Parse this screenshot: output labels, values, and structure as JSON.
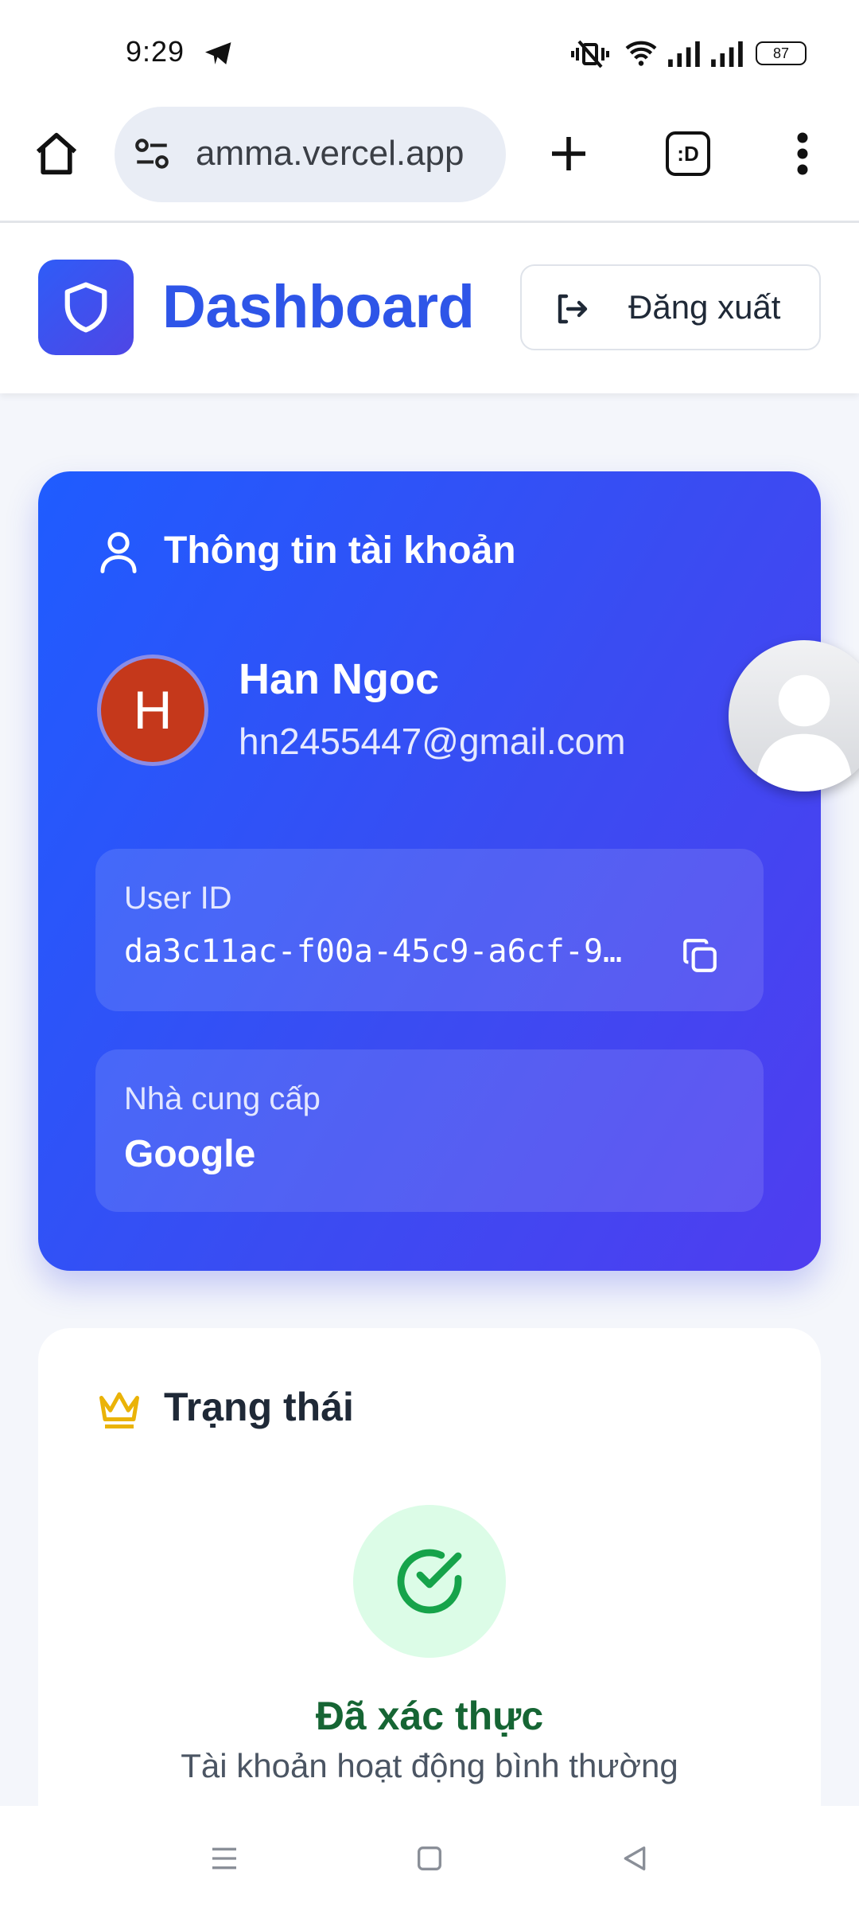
{
  "status_bar": {
    "time": "9:29",
    "battery": "87",
    "icons": [
      "telegram-icon",
      "mute-vibrate-icon",
      "wifi-icon",
      "signal-icon",
      "signal-icon",
      "battery-icon"
    ]
  },
  "browser": {
    "url": "amma.vercel.app",
    "tab_badge": ":D",
    "icons": [
      "home-icon",
      "site-settings-icon",
      "new-tab-icon",
      "tabs-icon",
      "menu-icon"
    ]
  },
  "header": {
    "brand": "Dashboard",
    "logout_label": "Đăng xuất"
  },
  "account": {
    "section_title": "Thông tin tài khoản",
    "avatar_initial": "H",
    "name": "Han Ngoc",
    "email": "hn2455447@gmail.com",
    "user_id_label": "User ID",
    "user_id_value": "da3c11ac-f00a-45c9-a6cf-9…",
    "provider_label": "Nhà cung cấp",
    "provider_value": "Google"
  },
  "status": {
    "section_title": "Trạng thái",
    "verified_label": "Đã xác thực",
    "verified_sub": "Tài khoản hoạt động bình thường"
  },
  "colors": {
    "accent": "#2e55e8",
    "card_gradient_start": "#1f5cff",
    "card_gradient_end": "#4f3df0",
    "success": "#16a34a",
    "crown": "#eab308"
  }
}
